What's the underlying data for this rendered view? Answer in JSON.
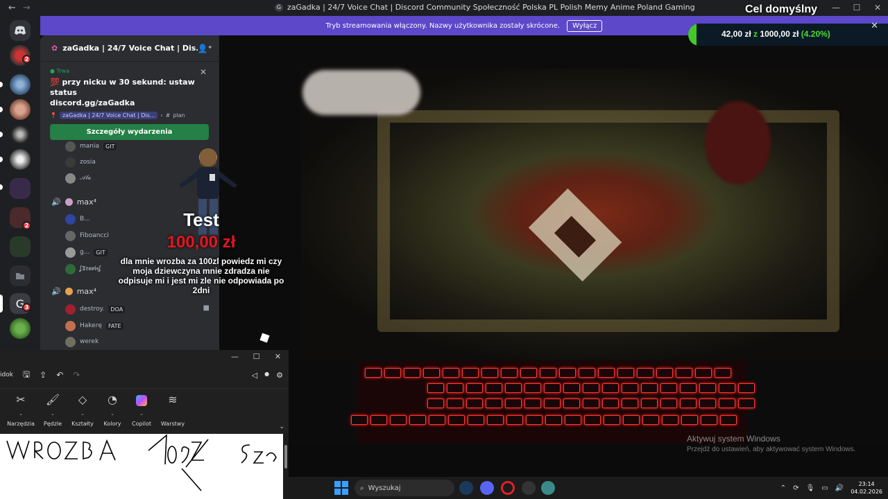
{
  "window": {
    "title": "zaGadka | 24/7 Voice Chat | Discord Community Społeczność Polska PL Polish Memy Anime Poland Gaming",
    "back": "←",
    "forward": "→",
    "controls": [
      "—",
      "☐",
      "✕"
    ]
  },
  "banner": {
    "text": "Tryb streamowania włączony. Nazwy użytkownika zostały skrócone.",
    "button": "Wyłącz"
  },
  "server": {
    "name": "zaGadka | 24/7 Voice Chat | Dis...",
    "invite_icon": "add-user-icon"
  },
  "event": {
    "status": "Trwa",
    "title_line1": "💯 przy nicku w 30 sekund: ustaw status",
    "title_line2": "discord.gg/zaGadka",
    "location_server": "zaGadka | 24/7 Voice Chat | Dis...",
    "location_channel": "plan",
    "button": "Szczegóły wydarzenia"
  },
  "voice": {
    "group1": [
      {
        "name": "mania",
        "tag": "GIT"
      },
      {
        "name": "zosia",
        "tag": ""
      },
      {
        "name": "𝒜𝓁𝒶",
        "tag": ""
      }
    ],
    "channel2": "max⁴",
    "group2": [
      {
        "name": "B...",
        "tag": ""
      },
      {
        "name": "Fiboancci",
        "tag": ""
      },
      {
        "name": "g...",
        "tag": "GIT"
      },
      {
        "name": "ʆ𝕿𝖗𝖆𝖛𝖎𝖘ʆ",
        "tag": ""
      }
    ],
    "channel3": "max⁴",
    "group3": [
      {
        "name": "destroy.",
        "tag": "DOA"
      },
      {
        "name": "Hakerę",
        "tag": "FATE"
      },
      {
        "name": "werek",
        "tag": ""
      }
    ]
  },
  "alert": {
    "name": "Test",
    "amount": "100,00 zł",
    "message": "dla mnie wrozba za 100zl powiedz mi czy moja dziewczyna mnie zdradza nie odpisuje mi i jest mi zle nie odpowiada po 2dni"
  },
  "goal": {
    "title": "Cel domyślny",
    "current": "42,00 zł",
    "separator": "z",
    "target": "1000,00 zł",
    "percent_label": "(4.20%)",
    "progress": 0.042,
    "color": "#43c72a"
  },
  "paint": {
    "menu_partial": "idok",
    "controls": [
      "—",
      "☐",
      "✕"
    ],
    "tools": [
      "Narzędzia",
      "Pędzle",
      "Kształty",
      "Kolory",
      "Copilot",
      "Warstwy"
    ],
    "handwriting": "WROZBA 100zł 5zł"
  },
  "watermark": {
    "line1": "Aktywuj system Windows",
    "line2": "Przejdź do ustawień, aby aktywować system Windows."
  },
  "taskbar": {
    "search_placeholder": "Wyszukaj",
    "time": "23:14",
    "date": "04.02.2026"
  }
}
